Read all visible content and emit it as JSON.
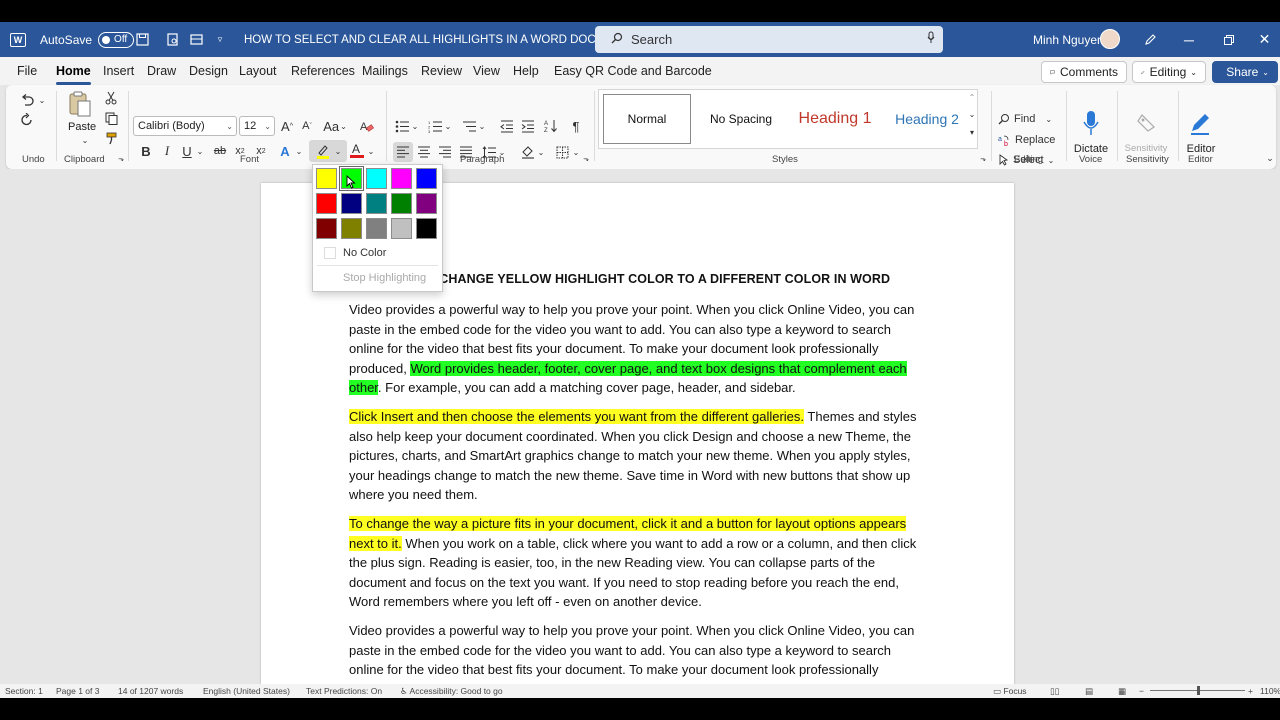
{
  "titlebar": {
    "app_letter": "W",
    "autosave_label": "AutoSave",
    "autosave_state": "Off",
    "doc_title": "HOW TO SELECT AND CLEAR ALL HIGHLIGHTS IN A WORD DOCUM...",
    "search_placeholder": "Search",
    "user_name": "Minh Nguyen"
  },
  "menu": {
    "tabs": [
      "File",
      "Home",
      "Insert",
      "Draw",
      "Design",
      "Layout",
      "References",
      "Mailings",
      "Review",
      "View",
      "Help",
      "Easy QR Code and Barcode"
    ],
    "active_tab": "Home",
    "comments_label": "Comments",
    "editing_label": "Editing",
    "share_label": "Share"
  },
  "ribbon": {
    "groups": {
      "undo": "Undo",
      "clipboard": "Clipboard",
      "font": "Font",
      "paragraph": "Paragraph",
      "styles": "Styles",
      "editing": "Editing",
      "voice": "Voice",
      "sensitivity": "Sensitivity",
      "editor": "Editor"
    },
    "paste_label": "Paste",
    "font_name": "Calibri (Body)",
    "font_size": "12",
    "styles": [
      "Normal",
      "No Spacing",
      "Heading 1",
      "Heading 2"
    ],
    "find_label": "Find",
    "replace_label": "Replace",
    "select_label": "Select",
    "dictate_label": "Dictate",
    "sensitivity_label": "Sensitivity",
    "editor_label": "Editor",
    "colors": {
      "accent": "#2b579a",
      "heading1": "#c0392b",
      "heading2": "#2e74b5"
    }
  },
  "highlight_menu": {
    "colors": [
      "#ffff00",
      "#00ff00",
      "#00ffff",
      "#ff00ff",
      "#0000ff",
      "#ff0000",
      "#000080",
      "#008080",
      "#008000",
      "#800080",
      "#800000",
      "#808000",
      "#808080",
      "#c0c0c0",
      "#000000"
    ],
    "selected_index": 1,
    "no_color_label": "No Color",
    "stop_label": "Stop Highlighting"
  },
  "document": {
    "heading": "HOW TO CHANGE YELLOW HIGHLIGHT COLOR TO A DIFFERENT COLOR IN WORD",
    "p1_a": "Video provides a powerful way to help you prove your point. When you click Online Video, you can paste in the embed code for the video you want to add. You can also type a keyword to search online for the video that best fits your document. To make your document look professionally produced, ",
    "p1_hl": "Word provides header, footer, cover page, and text box designs that complement each other",
    "p1_b": ". For example, you can add a matching cover page, header, and sidebar.",
    "p2_hl": "Click Insert and then choose the elements you want from the different galleries.",
    "p2_b": " Themes and styles also help keep your document coordinated. When you click Design and choose a new Theme, the pictures, charts, and SmartArt graphics change to match your new theme. When you apply styles, your headings change to match the new theme. Save time in Word with new buttons that show up where you need them.",
    "p3_hl": "To change the way a picture fits in your document, click it and a button for layout options appears next to it.",
    "p3_b": " When you work on a table, click where you want to add a row or a column, and then click the plus sign. Reading is easier, too, in the new Reading view. You can collapse parts of the document and focus on the text you want. If you need to stop reading before you reach the end, Word remembers where you left off - even on another device.",
    "p4": "Video provides a powerful way to help you prove your point. When you click Online Video, you can paste in the embed code for the video you want to add. You can also type a keyword to search online for the video that best fits your document. To make your document look professionally produced, Word provides header, footer, cover page, and text box designs that"
  },
  "status": {
    "section": "Section: 1",
    "page": "Page 1 of 3",
    "words": "14 of 1207 words",
    "language": "English (United States)",
    "predictions": "Text Predictions: On",
    "accessibility": "Accessibility: Good to go",
    "focus": "Focus",
    "zoom": "110%"
  }
}
